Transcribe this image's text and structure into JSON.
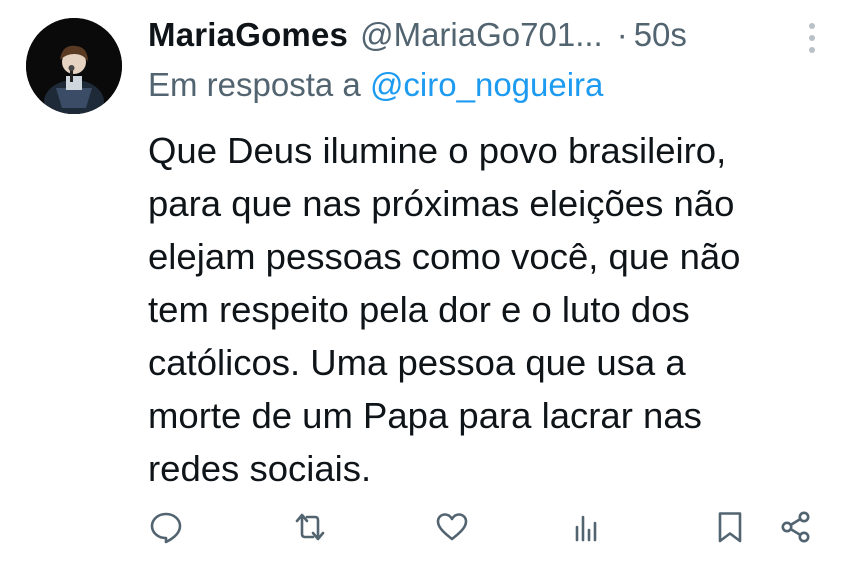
{
  "tweet": {
    "display_name": "MariaGomes",
    "handle": "@MariaGo701...",
    "separator": "·",
    "time": "50s",
    "reply_prefix": "Em resposta a",
    "reply_handle": "@ciro_nogueira",
    "body_lines": [
      "Que Deus ilumine o povo brasileiro,",
      "para que nas próximas eleições não",
      "elejam pessoas como você, que não",
      "tem respeito pela dor e o luto dos",
      "católicos. Uma pessoa que usa a",
      "morte de um Papa para lacrar nas",
      "redes sociais."
    ]
  },
  "icons": {
    "more": "more-vertical-icon",
    "reply": "reply-icon",
    "retweet": "retweet-icon",
    "like": "heart-icon",
    "views": "views-icon",
    "bookmark": "bookmark-icon",
    "share": "share-icon"
  },
  "colors": {
    "text": "#0f1419",
    "secondary": "#536471",
    "link": "#1d9bf0",
    "background": "#ffffff"
  }
}
